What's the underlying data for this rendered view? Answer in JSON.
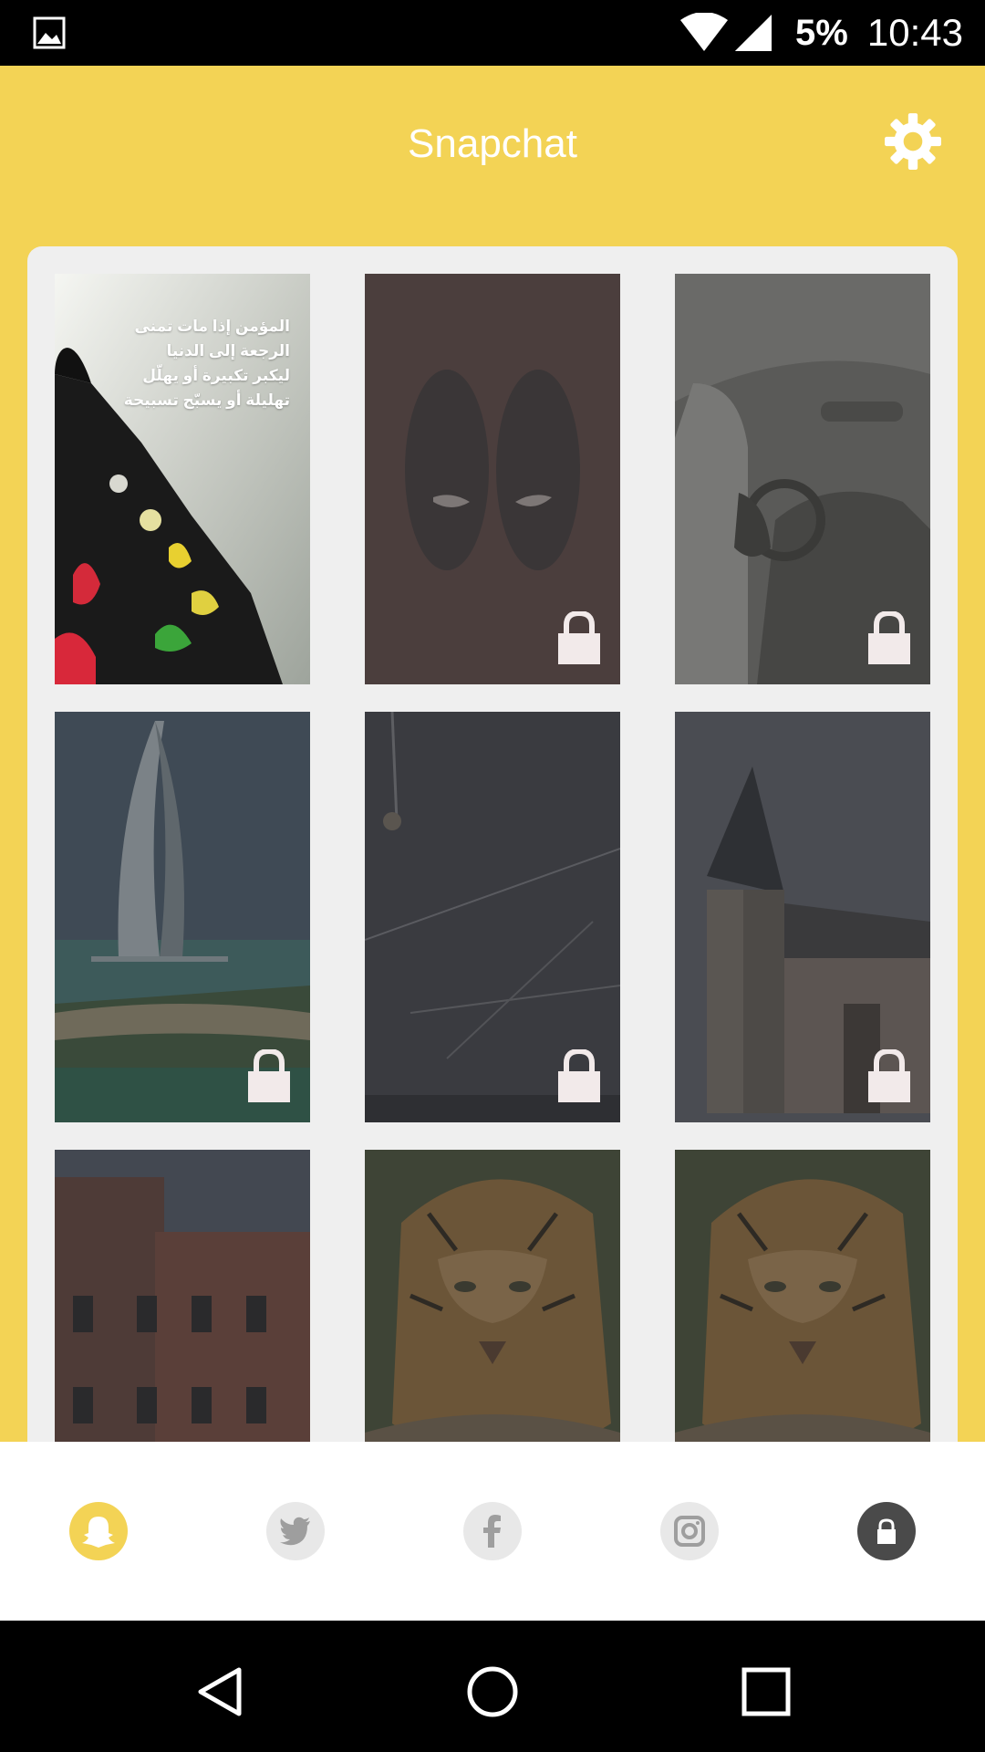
{
  "status_bar": {
    "battery": "5%",
    "time": "10:43",
    "icons": [
      "image-icon",
      "wifi-icon",
      "signal-icon"
    ]
  },
  "header": {
    "title": "Snapchat",
    "settings_icon": "gear-icon"
  },
  "grid": {
    "tiles": [
      {
        "id": "tile-1",
        "locked": false,
        "description_lines": [
          "المؤمن إذا مات تمنى",
          "الرجعة إلى الدنيا",
          "ليكبر تكبيرة أو يهلّل",
          "تهليلة أو يسبّح تسبيحة"
        ]
      },
      {
        "id": "tile-2",
        "locked": true
      },
      {
        "id": "tile-3",
        "locked": true
      },
      {
        "id": "tile-4",
        "locked": true
      },
      {
        "id": "tile-5",
        "locked": true
      },
      {
        "id": "tile-6",
        "locked": true
      },
      {
        "id": "tile-7",
        "locked": false
      },
      {
        "id": "tile-8",
        "locked": false
      },
      {
        "id": "tile-9",
        "locked": false
      }
    ]
  },
  "bottom_tabs": [
    {
      "name": "snapchat",
      "icon": "snapchat-ghost-icon",
      "active": true
    },
    {
      "name": "twitter",
      "icon": "twitter-bird-icon",
      "active": false
    },
    {
      "name": "facebook",
      "icon": "facebook-f-icon",
      "active": false
    },
    {
      "name": "instagram",
      "icon": "instagram-camera-icon",
      "active": false
    },
    {
      "name": "locked",
      "icon": "lock-icon",
      "active": false
    }
  ],
  "colors": {
    "accent": "#F3D355",
    "panel": "#EFEFEF",
    "inactive_tab": "#E8E8E8",
    "lock_tab": "#4A4A4A"
  }
}
